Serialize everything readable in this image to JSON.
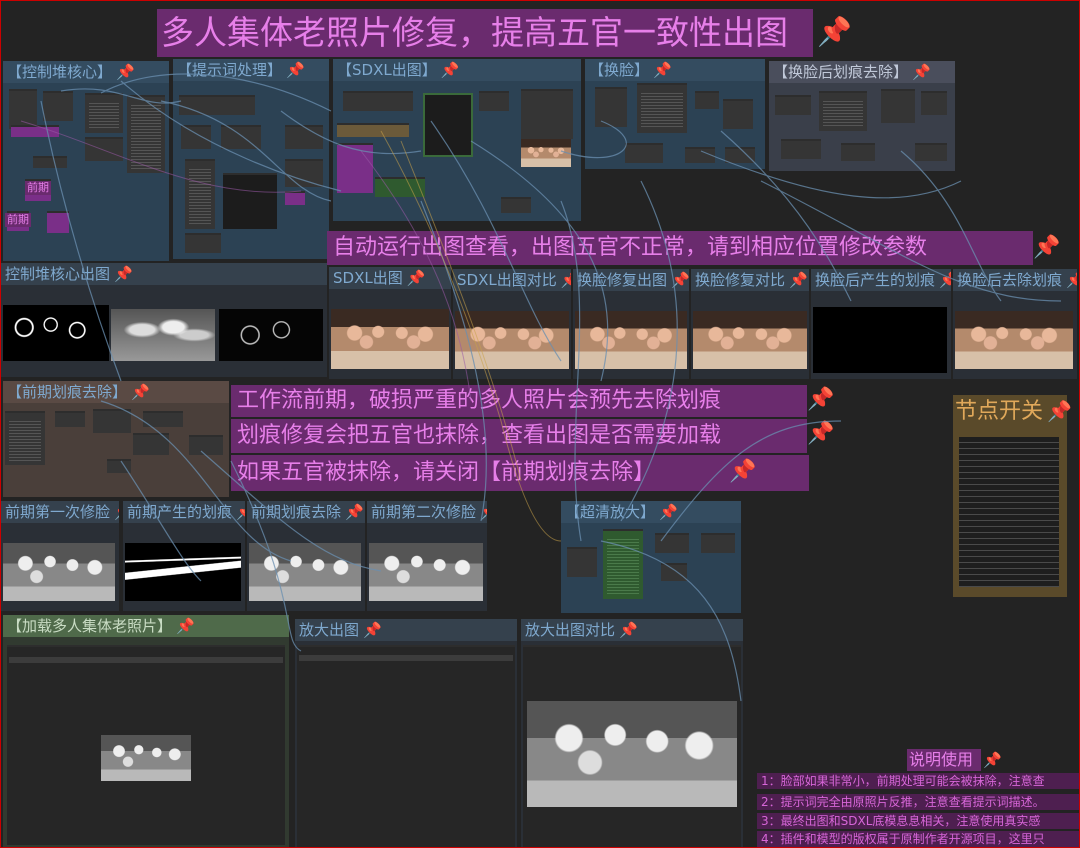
{
  "titles": {
    "main": "多人集体老照片修复，提高五官一致性出图",
    "auto_run": "自动运行出图查看，出图五官不正常，请到相应位置修改参数",
    "wf_line1": "工作流前期，破损严重的多人照片会预先去除划痕",
    "wf_line2": "划痕修复会把五官也抹除，查看出图是否需要加载",
    "wf_line3": "如果五官被抹除，请关闭【前期划痕去除】",
    "node_switch": "节点开关",
    "instructions": "说明使用"
  },
  "groups": {
    "control": "【控制堆核心】",
    "prompt": "【提示词处理】",
    "sdxl": "【SDXL出图】",
    "faceswap": "【换脸】",
    "scratch_after": "【换脸后划痕去除】",
    "control_out": "控制堆核心出图",
    "sdxl_out": "SDXL出图",
    "sdxl_compare": "SDXL出图对比",
    "face_fix_out": "换脸修复出图",
    "face_fix_compare": "换脸修复对比",
    "face_scratch": "换脸后产生的划痕",
    "face_scratch_removed": "换脸后去除划痕",
    "pre_scratch": "【前期划痕去除】",
    "pre_fix1": "前期第一次修脸",
    "pre_scratch_mask": "前期产生的划痕",
    "pre_scratch_removed": "前期划痕去除",
    "pre_fix2": "前期第二次修脸",
    "upscale": "【超清放大】",
    "load_photo": "【加载多人集体老照片】",
    "upscale_out": "放大出图",
    "upscale_compare": "放大出图对比"
  },
  "small_labels": {
    "lbl1": "前期",
    "lbl2": "前期"
  },
  "instruction_lines": [
    "1：脸部如果非常小，前期处理可能会被抹除，注意查",
    "2：提示词完全由原照片反推，注意查看提示词描述。",
    "3：最终出图和SDXL底模息息相关，注意使用真实感",
    "4：插件和模型的版权属于原制作者开源项目，这里只"
  ],
  "icons": {
    "pin": "pushpin-icon"
  },
  "colors": {
    "note_bg": "#6a2b6e",
    "note_fg": "#e77fe9",
    "pin": "#ff4848",
    "canvas": "#232323"
  }
}
